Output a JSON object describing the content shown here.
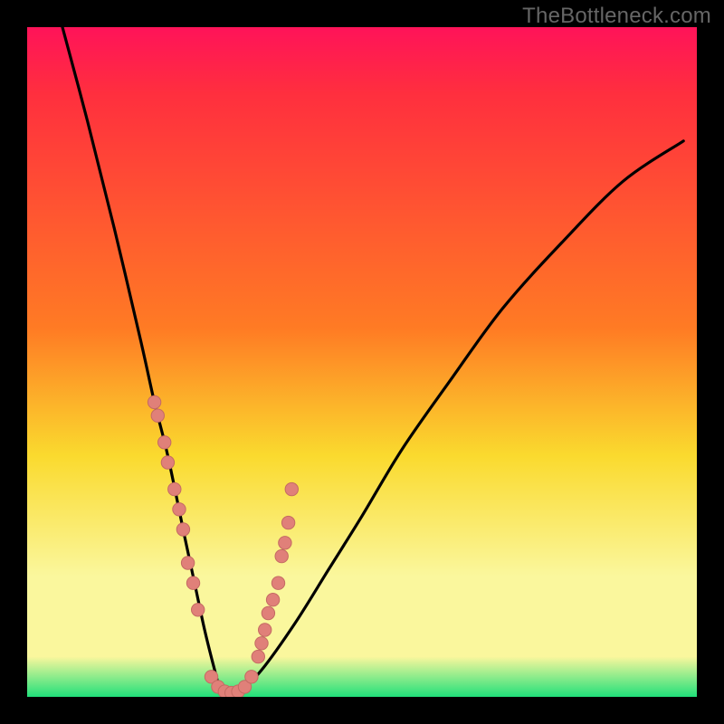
{
  "watermark": "TheBottleneck.com",
  "colors": {
    "pink": "#ff1359",
    "red": "#ff2f3e",
    "orange": "#ff7b24",
    "yellow": "#fada2e",
    "pale": "#faf79d",
    "green": "#21e07a",
    "curve_stroke": "#000000",
    "dot_fill": "#e08079",
    "dot_stroke": "#c46a63"
  },
  "chart_data": {
    "type": "line",
    "title": "",
    "xlabel": "",
    "ylabel": "",
    "xlim": [
      0,
      100
    ],
    "ylim": [
      0,
      100
    ],
    "series": [
      {
        "name": "bottleneck_curve",
        "x": [
          5,
          9,
          13,
          17,
          19,
          21,
          23.5,
          25,
          26.5,
          28,
          29,
          30,
          31.5,
          35,
          40,
          45,
          50,
          56,
          63,
          71,
          80,
          89,
          98
        ],
        "y": [
          101,
          86,
          70,
          53,
          44,
          36,
          24,
          17,
          10,
          4,
          0.5,
          0,
          0.5,
          4,
          11,
          19,
          27,
          37,
          47,
          58,
          68,
          77,
          83
        ]
      }
    ],
    "points": [
      {
        "name": "dots_left_branch",
        "xy": [
          [
            19,
            44
          ],
          [
            19.5,
            42
          ],
          [
            20.5,
            38
          ],
          [
            21,
            35
          ],
          [
            22,
            31
          ],
          [
            22.7,
            28
          ],
          [
            23.3,
            25
          ],
          [
            24,
            20
          ],
          [
            24.8,
            17
          ],
          [
            25.5,
            13
          ]
        ]
      },
      {
        "name": "dots_floor",
        "xy": [
          [
            27.5,
            3
          ],
          [
            28.5,
            1.5
          ],
          [
            29.5,
            0.8
          ],
          [
            30.5,
            0.6
          ],
          [
            31.5,
            0.8
          ],
          [
            32.5,
            1.5
          ],
          [
            33.5,
            3
          ]
        ]
      },
      {
        "name": "dots_right_branch",
        "xy": [
          [
            34.5,
            6
          ],
          [
            35,
            8
          ],
          [
            35.5,
            10
          ],
          [
            36,
            12.5
          ],
          [
            36.7,
            14.5
          ],
          [
            37.5,
            17
          ],
          [
            38,
            21
          ],
          [
            38.5,
            23
          ],
          [
            39,
            26
          ],
          [
            39.5,
            31
          ]
        ]
      }
    ],
    "gradient_stops": [
      {
        "pct": 0,
        "color_key": "pink"
      },
      {
        "pct": 10,
        "color_key": "red"
      },
      {
        "pct": 45,
        "color_key": "orange"
      },
      {
        "pct": 64,
        "color_key": "yellow"
      },
      {
        "pct": 82,
        "color_key": "pale"
      },
      {
        "pct": 94,
        "color_key": "pale"
      },
      {
        "pct": 100,
        "color_key": "green"
      }
    ]
  }
}
